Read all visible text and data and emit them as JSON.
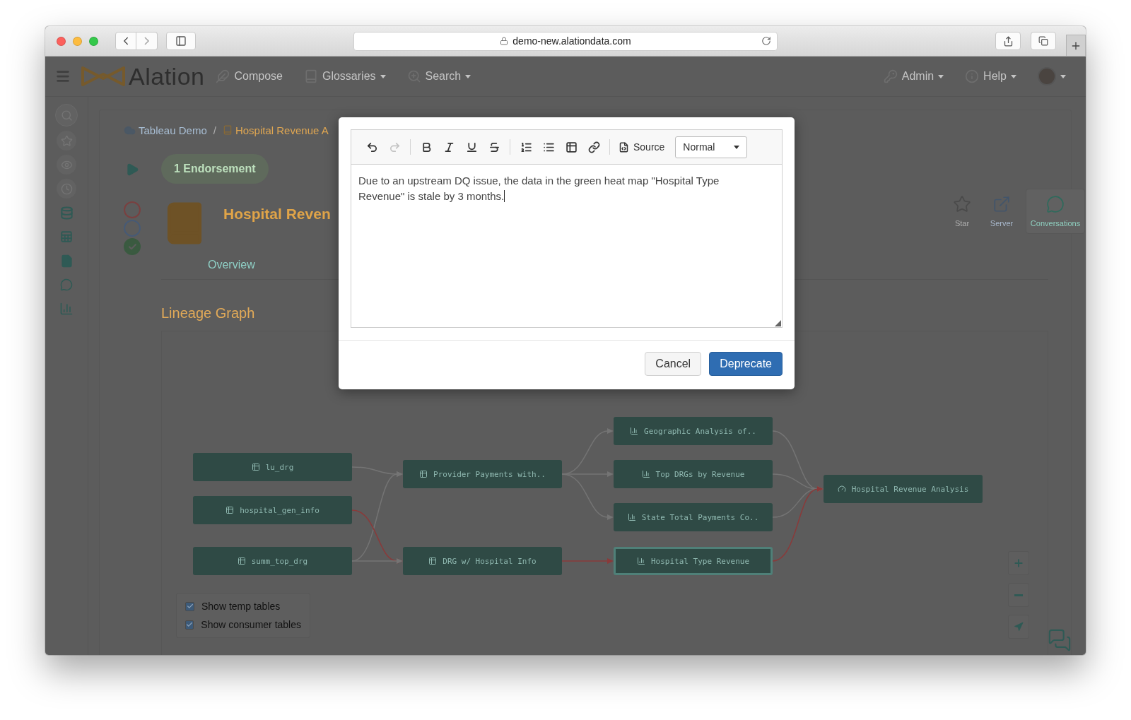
{
  "browser": {
    "url": "demo-new.alationdata.com"
  },
  "navbar": {
    "logo": "Alation",
    "items": [
      {
        "kind": "compose",
        "label": "Compose",
        "dropdown": false
      },
      {
        "kind": "glossaries",
        "label": "Glossaries",
        "dropdown": true
      },
      {
        "kind": "search",
        "label": "Search",
        "dropdown": true
      }
    ],
    "right_items": [
      {
        "kind": "admin",
        "label": "Admin",
        "dropdown": true
      },
      {
        "kind": "help",
        "label": "Help",
        "dropdown": true
      }
    ]
  },
  "breadcrumb": [
    {
      "kind": "source",
      "label": "Tableau Demo"
    },
    {
      "kind": "book",
      "separator": "/",
      "label": "Hospital Revenue A"
    }
  ],
  "endorsement": "1 Endorsement",
  "title": "Hospital Reven",
  "tabs": [
    {
      "label": "Overview"
    }
  ],
  "actions": [
    {
      "kind": "star",
      "label": "Star",
      "selected": false
    },
    {
      "kind": "server",
      "label": "Server",
      "selected": false
    },
    {
      "kind": "conversations",
      "label": "Conversations",
      "selected": true
    }
  ],
  "lineage": {
    "title": "Lineage Graph",
    "nodes": [
      {
        "kind": "table",
        "label": "lu_drg",
        "selected": false
      },
      {
        "kind": "table",
        "label": "hospital_gen_info",
        "selected": false
      },
      {
        "kind": "table",
        "label": "summ_top_drg",
        "selected": false
      },
      {
        "kind": "table",
        "label": "Provider Payments with..",
        "selected": false
      },
      {
        "kind": "table",
        "label": "DRG w/ Hospital Info",
        "selected": false
      },
      {
        "kind": "chart",
        "label": "Geographic Analysis of..",
        "selected": false
      },
      {
        "kind": "chart",
        "label": "Top DRGs by Revenue",
        "selected": false
      },
      {
        "kind": "chart",
        "label": "State Total Payments Co..",
        "selected": false
      },
      {
        "kind": "chart",
        "label": "Hospital Type Revenue",
        "selected": true
      },
      {
        "kind": "dashboard",
        "label": "Hospital Revenue Analysis",
        "selected": false
      }
    ],
    "edges": [
      {
        "highlighted": false
      },
      {
        "highlighted": false
      },
      {
        "highlighted": true
      },
      {
        "highlighted": false
      },
      {
        "highlighted": false
      },
      {
        "highlighted": false
      },
      {
        "highlighted": false
      },
      {
        "highlighted": false
      },
      {
        "highlighted": false
      },
      {
        "highlighted": false
      },
      {
        "highlighted": true
      },
      {
        "highlighted": true
      }
    ],
    "options": [
      {
        "label": "Show temp tables",
        "checked": true
      },
      {
        "label": "Show consumer tables",
        "checked": true
      }
    ]
  },
  "modal": {
    "toolbar": [
      {
        "kind": "undo",
        "disabled": false
      },
      {
        "kind": "redo",
        "disabled": true
      },
      {
        "kind": "separator"
      },
      {
        "kind": "bold",
        "disabled": false
      },
      {
        "kind": "italic",
        "disabled": false
      },
      {
        "kind": "underline",
        "disabled": false
      },
      {
        "kind": "strike",
        "disabled": false
      },
      {
        "kind": "separator"
      },
      {
        "kind": "ordered-list",
        "disabled": false
      },
      {
        "kind": "bullet-list",
        "disabled": false
      },
      {
        "kind": "table",
        "disabled": false
      },
      {
        "kind": "link",
        "disabled": false
      },
      {
        "kind": "separator"
      },
      {
        "kind": "source",
        "label": "Source",
        "disabled": false
      }
    ],
    "format": "Normal",
    "text": "Due to an upstream DQ issue, the data in the green heat map \"Hospital Type Revenue\" is stale by 3 months.",
    "buttons": [
      {
        "label": "Cancel",
        "primary": false
      },
      {
        "label": "Deprecate",
        "primary": true
      }
    ]
  }
}
